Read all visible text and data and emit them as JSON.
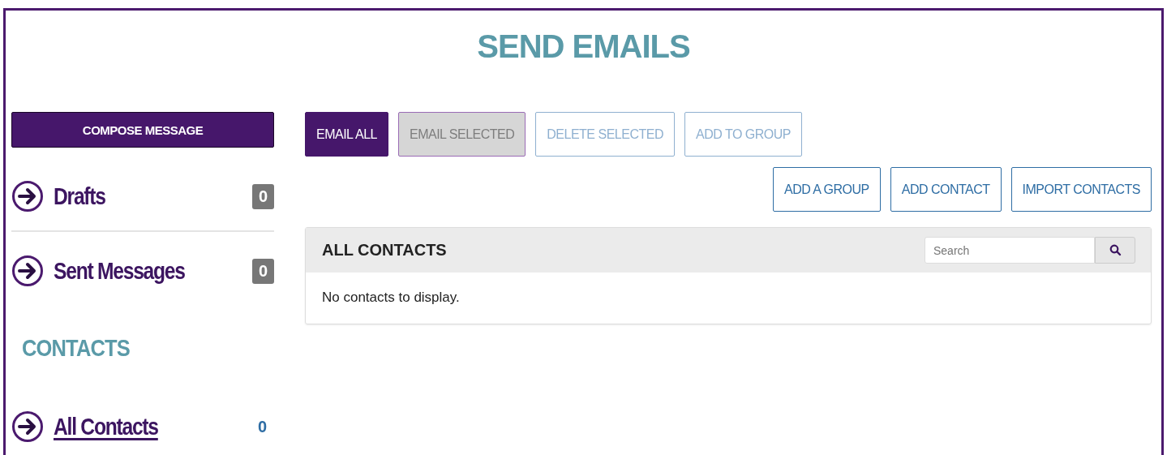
{
  "page": {
    "title": "SEND EMAILS"
  },
  "sidebar": {
    "compose_button": "COMPOSE MESSAGE",
    "items": [
      {
        "label": "Drafts",
        "count": "0",
        "kind": "badge",
        "selected": false
      },
      {
        "label": "Sent Messages",
        "count": "0",
        "kind": "badge",
        "selected": false
      }
    ],
    "contacts_heading": "CONTACTS",
    "contact_items": [
      {
        "label": "All Contacts",
        "count": "0",
        "kind": "plain",
        "selected": true
      }
    ]
  },
  "toolbar": {
    "row_1": [
      {
        "label": "EMAIL ALL",
        "kind": "primary",
        "disabled": false
      },
      {
        "label": "EMAIL SELECTED",
        "kind": "primary",
        "disabled": true
      },
      {
        "label": "DELETE SELECTED",
        "kind": "outline",
        "disabled": true
      },
      {
        "label": "ADD TO GROUP",
        "kind": "outline",
        "disabled": true
      }
    ],
    "row_2": [
      {
        "label": "ADD A GROUP",
        "kind": "outline",
        "disabled": false
      },
      {
        "label": "ADD CONTACT",
        "kind": "outline",
        "disabled": false
      },
      {
        "label": "IMPORT CONTACTS",
        "kind": "outline",
        "disabled": false
      }
    ]
  },
  "contacts_panel": {
    "title": "ALL CONTACTS",
    "search": {
      "placeholder": "Search"
    },
    "empty_message": "No contacts to display."
  }
}
